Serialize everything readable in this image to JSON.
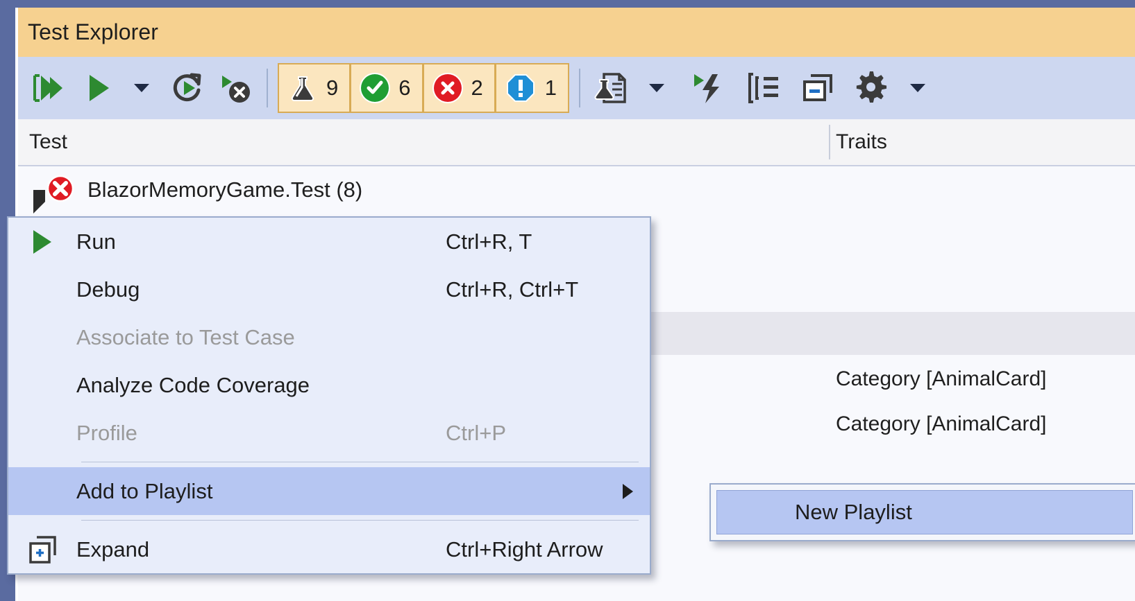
{
  "window": {
    "title": "Test Explorer",
    "frame_color": "#5a6ba0",
    "title_bg": "#f6d190",
    "toolbar_bg": "#cdd7f0"
  },
  "toolbar": {
    "buttons": [
      {
        "name": "run-all-tests",
        "icon": "run-all-icon"
      },
      {
        "name": "run-tests",
        "icon": "play-icon"
      },
      {
        "name": "run-dropdown",
        "icon": "chevron-down-icon"
      },
      {
        "name": "repeat-last-run",
        "icon": "repeat-run-icon"
      },
      {
        "name": "run-until-failure",
        "icon": "run-until-fail-icon"
      }
    ],
    "badges": [
      {
        "name": "total-tests-badge",
        "icon": "flask-icon",
        "count": "9",
        "color": "#3b3b3b"
      },
      {
        "name": "passed-tests-badge",
        "icon": "check-circle-icon",
        "count": "6",
        "color": "#1f9e34"
      },
      {
        "name": "failed-tests-badge",
        "icon": "error-circle-icon",
        "count": "2",
        "color": "#e01b24"
      },
      {
        "name": "not-run-tests-badge",
        "icon": "warning-octagon-icon",
        "count": "1",
        "color": "#1f8fd6"
      }
    ],
    "right_buttons": [
      {
        "name": "test-detail-summary",
        "icon": "test-document-icon"
      },
      {
        "name": "test-detail-dropdown",
        "icon": "chevron-down-icon"
      },
      {
        "name": "run-with-profiler",
        "icon": "play-lightning-icon"
      },
      {
        "name": "group-by",
        "icon": "group-list-icon"
      },
      {
        "name": "collapse-all",
        "icon": "collapse-all-icon"
      },
      {
        "name": "settings",
        "icon": "gear-icon"
      },
      {
        "name": "settings-dropdown",
        "icon": "chevron-down-icon"
      }
    ]
  },
  "grid": {
    "columns": [
      {
        "name": "test",
        "label": "Test"
      },
      {
        "name": "traits",
        "label": "Traits"
      }
    ],
    "rows": [
      {
        "name": "test-group-row",
        "status": "failed",
        "status_icon": "error-circle-icon",
        "expander": "expanded",
        "label": "BlazorMemoryGame.Test  (8)",
        "traits": ""
      }
    ],
    "trait_cells": [
      "Category [AnimalCard]",
      "Category [AnimalCard]"
    ]
  },
  "context_menu": {
    "items": [
      {
        "name": "run",
        "label": "Run",
        "shortcut": "Ctrl+R, T",
        "icon": "play-icon",
        "disabled": false,
        "highlight": false,
        "submenu": false
      },
      {
        "name": "debug",
        "label": "Debug",
        "shortcut": "Ctrl+R, Ctrl+T",
        "icon": "",
        "disabled": false,
        "highlight": false,
        "submenu": false
      },
      {
        "name": "associate-to-test-case",
        "label": "Associate to Test Case",
        "shortcut": "",
        "icon": "",
        "disabled": true,
        "highlight": false,
        "submenu": false
      },
      {
        "name": "analyze-code-coverage",
        "label": "Analyze Code Coverage",
        "shortcut": "",
        "icon": "",
        "disabled": false,
        "highlight": false,
        "submenu": false
      },
      {
        "name": "profile",
        "label": "Profile",
        "shortcut": "Ctrl+P",
        "icon": "",
        "disabled": true,
        "highlight": false,
        "submenu": false
      },
      {
        "name": "add-to-playlist",
        "label": "Add to Playlist",
        "shortcut": "",
        "icon": "",
        "disabled": false,
        "highlight": true,
        "submenu": true
      },
      {
        "name": "expand",
        "label": "Expand",
        "shortcut": "Ctrl+Right Arrow",
        "icon": "expand-icon",
        "disabled": false,
        "highlight": false,
        "submenu": false
      }
    ]
  },
  "submenu": {
    "items": [
      {
        "name": "new-playlist",
        "label": "New Playlist",
        "highlight": true
      }
    ]
  },
  "colors": {
    "accent_blue": "#5a6ba0",
    "title_orange": "#f6d190",
    "toolbar_blue": "#cdd7f0",
    "menu_bg": "#e8edfa",
    "highlight": "#b6c6f2",
    "badge_bg": "#fbe6bf",
    "badge_border": "#d8ab55"
  }
}
